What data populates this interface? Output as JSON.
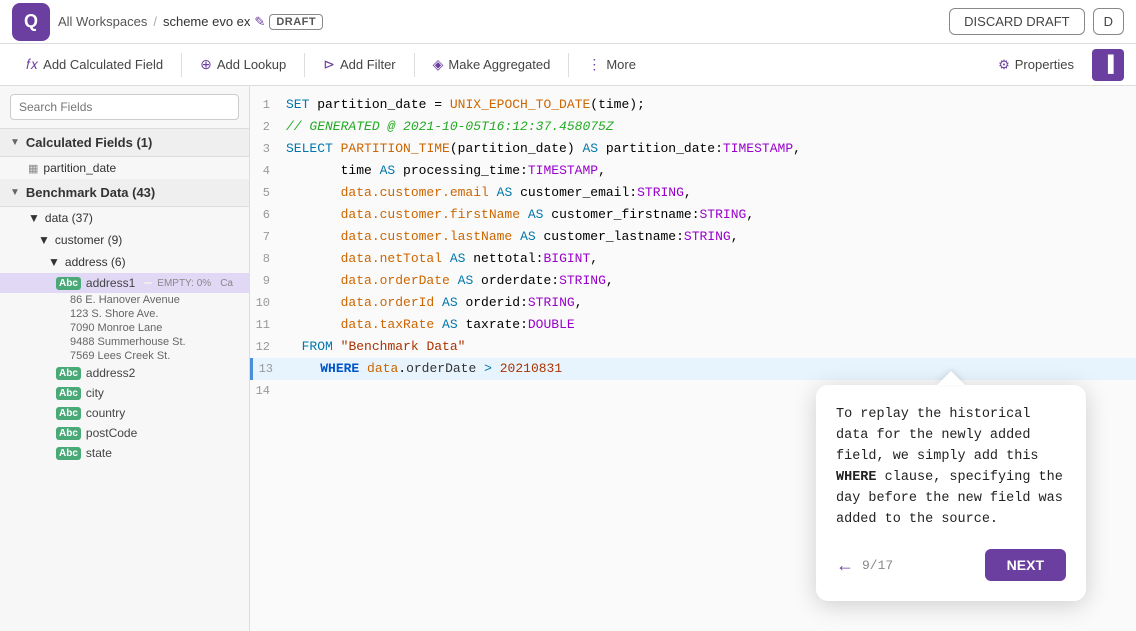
{
  "topbar": {
    "logo_text": "Q",
    "breadcrumb_workspace": "All Workspaces",
    "breadcrumb_sep": "/",
    "scheme_name": "scheme evo ex",
    "edit_icon": "✎",
    "draft_label": "DRAFT",
    "discard_draft_label": "DISCARD DRAFT",
    "d_label": "D"
  },
  "toolbar": {
    "add_calculated_field": "Add Calculated Field",
    "add_lookup": "Add Lookup",
    "add_filter": "Add Filter",
    "make_aggregated": "Make Aggregated",
    "more": "More",
    "properties": "Properties"
  },
  "sidebar": {
    "search_placeholder": "Search Fields",
    "calculated_fields_label": "Calculated Fields (1)",
    "partition_date_label": "partition_date",
    "benchmark_data_label": "Benchmark Data (43)",
    "data_label": "data (37)",
    "customer_label": "customer (9)",
    "address_label": "address (6)",
    "fields": {
      "address1": {
        "name": "address1",
        "empty": "EMPTY: 0%",
        "calc": "Ca"
      },
      "samples": [
        "86 E. Hanover Avenue",
        "123 S. Shore Ave.",
        "7090 Monroe Lane",
        "9488 Summerhouse St.",
        "7569 Lees Creek St."
      ],
      "address2": "address2",
      "city": "city",
      "country": "country",
      "postCode": "postCode",
      "state": "state"
    }
  },
  "code": {
    "lines": [
      {
        "num": 1,
        "content": "SET partition_date = UNIX_EPOCH_TO_DATE(time);"
      },
      {
        "num": 2,
        "content": "// GENERATED @ 2021-10-05T16:12:37.458075Z"
      },
      {
        "num": 3,
        "content": "SELECT PARTITION_TIME(partition_date) AS partition_date:TIMESTAMP,"
      },
      {
        "num": 4,
        "content": "       time AS processing_time:TIMESTAMP,"
      },
      {
        "num": 5,
        "content": "       data.customer.email AS customer_email:STRING,"
      },
      {
        "num": 6,
        "content": "       data.customer.firstName AS customer_firstname:STRING,"
      },
      {
        "num": 7,
        "content": "       data.customer.lastName AS customer_lastname:STRING,"
      },
      {
        "num": 8,
        "content": "       data.netTotal AS nettotal:BIGINT,"
      },
      {
        "num": 9,
        "content": "       data.orderDate AS orderdate:STRING,"
      },
      {
        "num": 10,
        "content": "       data.orderId AS orderid:STRING,"
      },
      {
        "num": 11,
        "content": "       data.taxRate AS taxrate:DOUBLE"
      },
      {
        "num": 12,
        "content": "  FROM \"Benchmark Data\""
      },
      {
        "num": 13,
        "content": "  WHERE data.orderDate > 20210831",
        "active": true
      },
      {
        "num": 14,
        "content": ""
      }
    ]
  },
  "tooltip": {
    "text_before": "To replay the historical data for the newly added field, we simply add this ",
    "text_bold": "WHERE",
    "text_after": " clause, specifying the day before the new field was added to the source.",
    "page": "9/17",
    "next_label": "NEXT",
    "back_icon": "←"
  }
}
